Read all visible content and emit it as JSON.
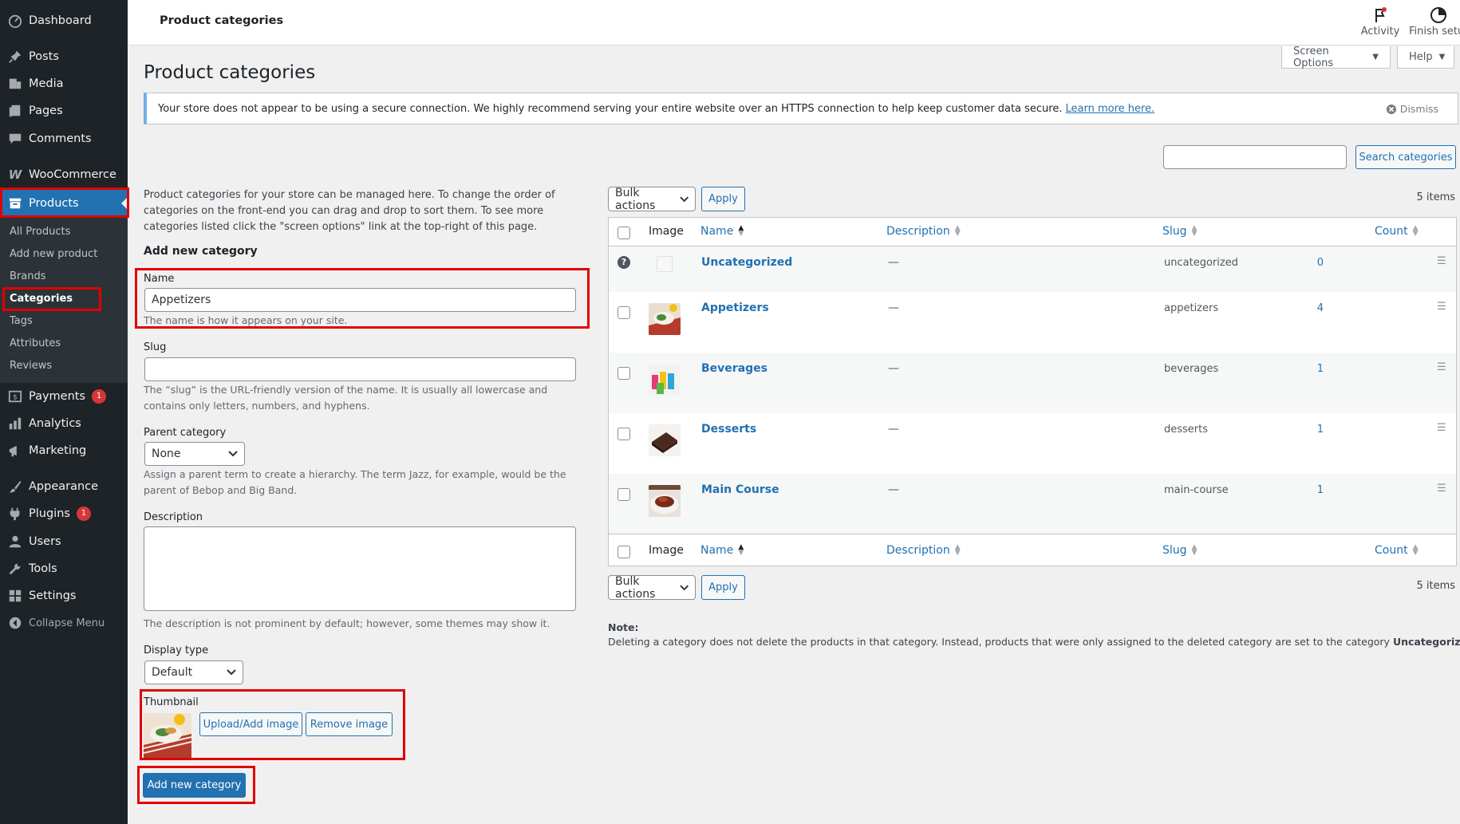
{
  "sidebar": {
    "items": [
      {
        "label": "Dashboard",
        "icon": "dashboard-icon"
      },
      {
        "label": "Posts",
        "icon": "pin-icon"
      },
      {
        "label": "Media",
        "icon": "media-icon"
      },
      {
        "label": "Pages",
        "icon": "pages-icon"
      },
      {
        "label": "Comments",
        "icon": "comment-icon"
      },
      {
        "label": "WooCommerce",
        "icon": "woocommerce-icon"
      },
      {
        "label": "Products",
        "icon": "archive-icon"
      },
      {
        "label": "Payments",
        "icon": "payments-icon",
        "badge": "1"
      },
      {
        "label": "Analytics",
        "icon": "analytics-icon"
      },
      {
        "label": "Marketing",
        "icon": "megaphone-icon"
      },
      {
        "label": "Appearance",
        "icon": "brush-icon"
      },
      {
        "label": "Plugins",
        "icon": "plugin-icon",
        "badge": "1"
      },
      {
        "label": "Users",
        "icon": "user-icon"
      },
      {
        "label": "Tools",
        "icon": "wrench-icon"
      },
      {
        "label": "Settings",
        "icon": "settings-icon"
      },
      {
        "label": "Collapse Menu",
        "icon": "collapse-icon"
      }
    ],
    "submenu": [
      "All Products",
      "Add new product",
      "Brands",
      "Categories",
      "Tags",
      "Attributes",
      "Reviews"
    ]
  },
  "topbar": {
    "title": "Product categories",
    "activity_label": "Activity",
    "finish_label": "Finish setup"
  },
  "screen_options_label": "Screen Options",
  "help_label": "Help",
  "page_title": "Product categories",
  "notice": {
    "text": "Your store does not appear to be using a secure connection. We highly recommend serving your entire website over an HTTPS connection to help keep customer data secure.",
    "link": "Learn more here.",
    "dismiss": "Dismiss"
  },
  "search": {
    "value": "",
    "button": "Search categories"
  },
  "intro": "Product categories for your store can be managed here. To change the order of categories on the front-end you can drag and drop to sort them. To see more categories listed click the \"screen options\" link at the top-right of this page.",
  "form": {
    "heading": "Add new category",
    "name_label": "Name",
    "name_value": "Appetizers",
    "name_help": "The name is how it appears on your site.",
    "slug_label": "Slug",
    "slug_value": "",
    "slug_help": "The “slug” is the URL-friendly version of the name. It is usually all lowercase and contains only letters, numbers, and hyphens.",
    "parent_label": "Parent category",
    "parent_value": "None",
    "parent_help": "Assign a parent term to create a hierarchy. The term Jazz, for example, would be the parent of Bebop and Big Band.",
    "desc_label": "Description",
    "desc_value": "",
    "desc_help": "The description is not prominent by default; however, some themes may show it.",
    "display_label": "Display type",
    "display_value": "Default",
    "thumb_label": "Thumbnail",
    "upload_btn": "Upload/Add image",
    "remove_btn": "Remove image",
    "submit_btn": "Add new category"
  },
  "table": {
    "bulk_label": "Bulk actions",
    "apply_label": "Apply",
    "items_count": "5 items",
    "headers": {
      "image": "Image",
      "name": "Name",
      "description": "Description",
      "slug": "Slug",
      "count": "Count"
    },
    "rows": [
      {
        "name": "Uncategorized",
        "description": "—",
        "slug": "uncategorized",
        "count": "0"
      },
      {
        "name": "Appetizers",
        "description": "—",
        "slug": "appetizers",
        "count": "4"
      },
      {
        "name": "Beverages",
        "description": "—",
        "slug": "beverages",
        "count": "1"
      },
      {
        "name": "Desserts",
        "description": "—",
        "slug": "desserts",
        "count": "1"
      },
      {
        "name": "Main Course",
        "description": "—",
        "slug": "main-course",
        "count": "1"
      }
    ]
  },
  "note": {
    "heading": "Note:",
    "text": "Deleting a category does not delete the products in that category. Instead, products that were only assigned to the deleted category are set to the category",
    "bold": "Uncategorized",
    "end": "."
  }
}
